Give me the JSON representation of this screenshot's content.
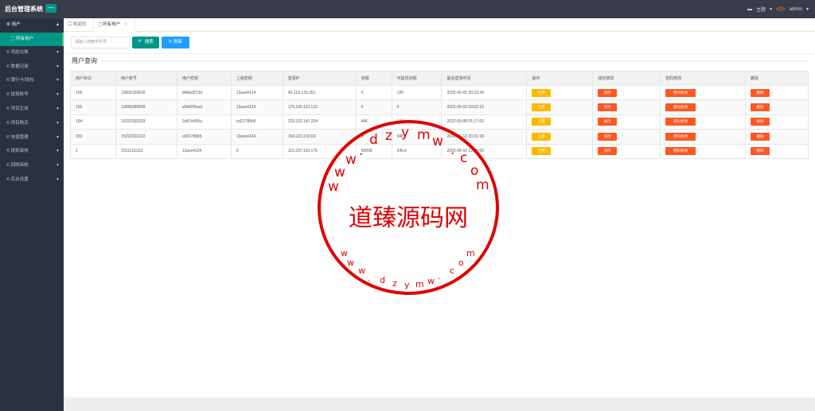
{
  "app": {
    "title": "后台管理系统",
    "menu_toggle": "—"
  },
  "topbar": {
    "theme": "主题",
    "user": "admin"
  },
  "sidebar": {
    "items": [
      {
        "label": "用户",
        "open": true
      },
      {
        "label": "奖励兑换"
      },
      {
        "label": "数据记录"
      },
      {
        "label": "银行卡/钱包"
      },
      {
        "label": "提现帐号"
      },
      {
        "label": "项目生成"
      },
      {
        "label": "项目购买"
      },
      {
        "label": "充值管理"
      },
      {
        "label": "提现审核"
      },
      {
        "label": "回购审核"
      },
      {
        "label": "后台设置"
      }
    ],
    "sub_active": "所有用户"
  },
  "tabs": [
    {
      "label": "欢迎页"
    },
    {
      "label": "所有用户",
      "closable": "×"
    }
  ],
  "search": {
    "placeholder": "请输入搜索手机号",
    "search_label": "搜索",
    "refresh_label": "刷新"
  },
  "section_title": "用户查询",
  "table": {
    "headers": [
      "用户标识",
      "用户帐号",
      "用户密钥",
      "上级密钥",
      "登录IP",
      "余额",
      "可提现余额",
      "最后登录时间",
      "操作",
      "钱包修改",
      "密码修改",
      "删除"
    ],
    "rows": [
      {
        "id": "156",
        "account": "13605326656",
        "key": "d4bbd273d",
        "parent_key": "13asx4124",
        "ip": "45.123.130.251",
        "balance": "0",
        "withdrawable": "120",
        "last_login": "2022-06-02 20:22:34"
      },
      {
        "id": "155",
        "account": "13696999999",
        "key": "e5d426ead",
        "parent_key": "13asx4124",
        "ip": "175.100.112.133",
        "balance": "0",
        "withdrawable": "0",
        "last_login": "2022-06-02 09:02:15"
      },
      {
        "id": "154",
        "account": "15333333333",
        "key": "2e87e605a",
        "parent_key": "cd21789b5",
        "ip": "223.102.147.224",
        "balance": "446",
        "withdrawable": "100",
        "last_login": "2022-05-08 01:17:02"
      },
      {
        "id": "153",
        "account": "15222222222",
        "key": "cd21789b5",
        "parent_key": "13asx4124",
        "ip": "154.222.233.53",
        "balance": "0",
        "withdrawable": "948",
        "last_login": "2022-05-12 20:31:18"
      },
      {
        "id": "1",
        "account": "15111111111",
        "key": "13asx4124",
        "parent_key": "0",
        "ip": "119.237.193.176",
        "balance": "99999",
        "withdrawable": "245.6",
        "last_login": "2022-08-10 12:18:00"
      }
    ],
    "action_labels": {
      "enable": "启用",
      "wallet_edit": "修改",
      "password_edit": "密码修改",
      "delete": "删除"
    }
  },
  "watermark": {
    "center_text": "道臻源码网"
  },
  "colors": {
    "primary": "#009688",
    "blue": "#1e9fff",
    "warn": "#ffb800",
    "danger": "#ff5722",
    "sidebar": "#28333e",
    "topbar": "#393d49",
    "stamp": "#e00000"
  }
}
